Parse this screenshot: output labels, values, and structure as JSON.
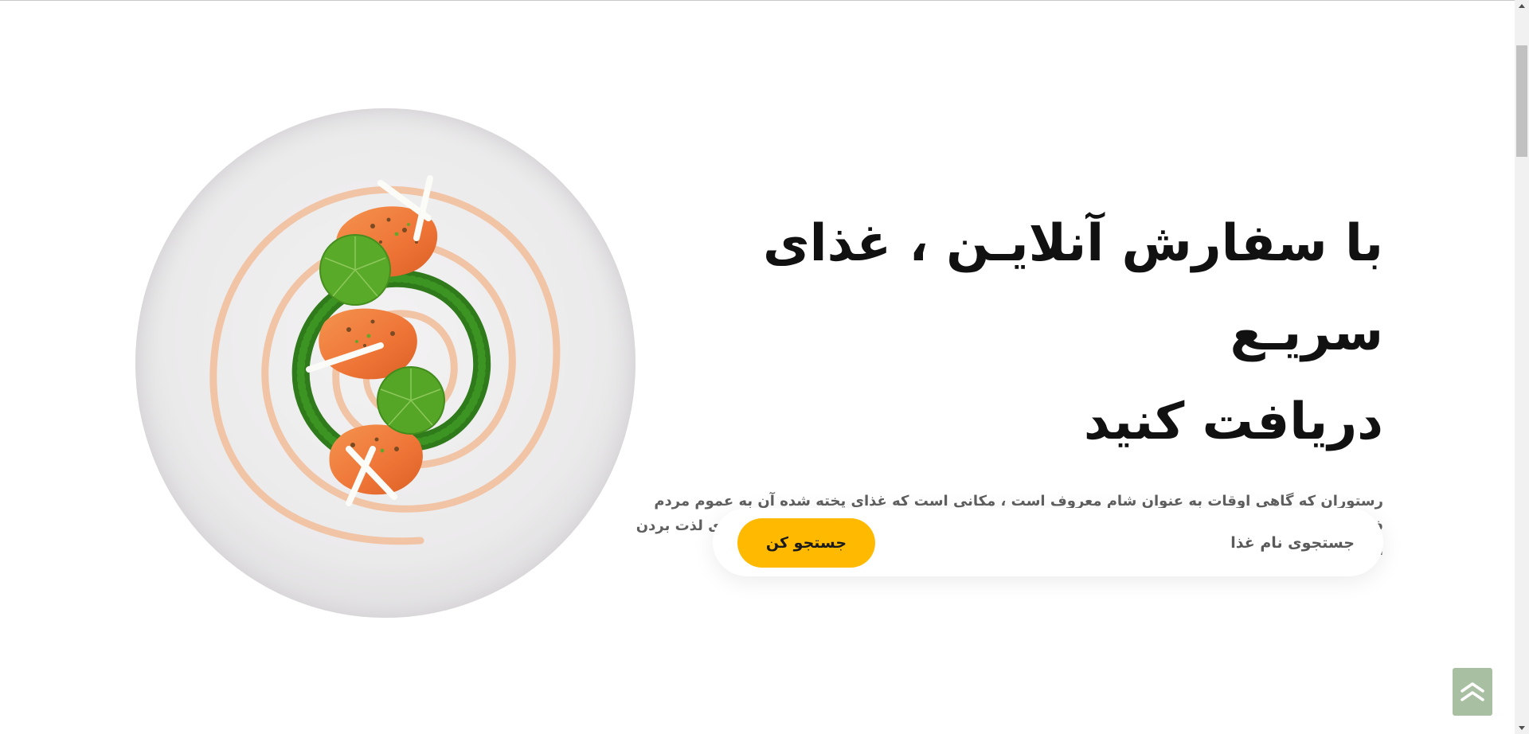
{
  "hero": {
    "title_line1": "با سفارش آنلایـن ، غذای سریـع",
    "title_line2": "دریافت کنید",
    "description": "رستوران که گاهی اوقات به عنوان شام معروف است ، مکانی است که غذای پخته شده آن به عموم مردم فروخته می شود و جایی که افراد برای خوردن آن می نشینند. همچنین مکانی است که مردم برای لذت بردن از وقت و خوردن یک وعده غذایی به آنجا می روند."
  },
  "search": {
    "placeholder": "جستجوی نام غذا",
    "button_label": "جستجو کن"
  },
  "colors": {
    "accent": "#ffba00",
    "back_to_top": "#a9bfa2",
    "title": "#111111",
    "description": "#5f5f5f"
  },
  "icons": {
    "hero_image": "plated-salmon-dish",
    "back_to_top": "double-chevron-up-icon"
  }
}
